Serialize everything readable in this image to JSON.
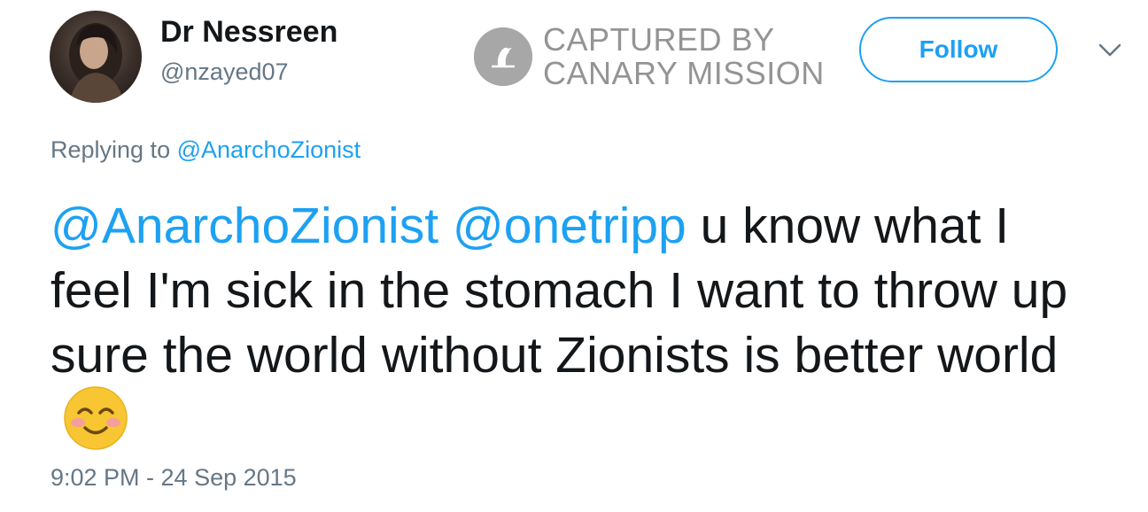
{
  "author": {
    "display_name": "Dr Nessreen",
    "handle": "@nzayed07"
  },
  "watermark": {
    "line1": "CAPTURED BY",
    "line2": "CANARY MISSION",
    "icon": "canary-bird-icon"
  },
  "actions": {
    "follow_label": "Follow",
    "more_icon": "chevron-down-icon"
  },
  "reply": {
    "prefix": "Replying to",
    "target": "@AnarchoZionist"
  },
  "tweet": {
    "mention1": "@AnarchoZionist",
    "mention2": "@onetripp",
    "body": "u know what I feel I'm sick in the stomach I want to throw up sure the world without Zionists is better world",
    "emoji": "smiling-face-with-smiling-eyes-emoji"
  },
  "timestamp": "9:02 PM - 24 Sep 2015",
  "colors": {
    "link": "#1da1f2",
    "secondary_text": "#657786",
    "primary_text": "#14171a"
  }
}
